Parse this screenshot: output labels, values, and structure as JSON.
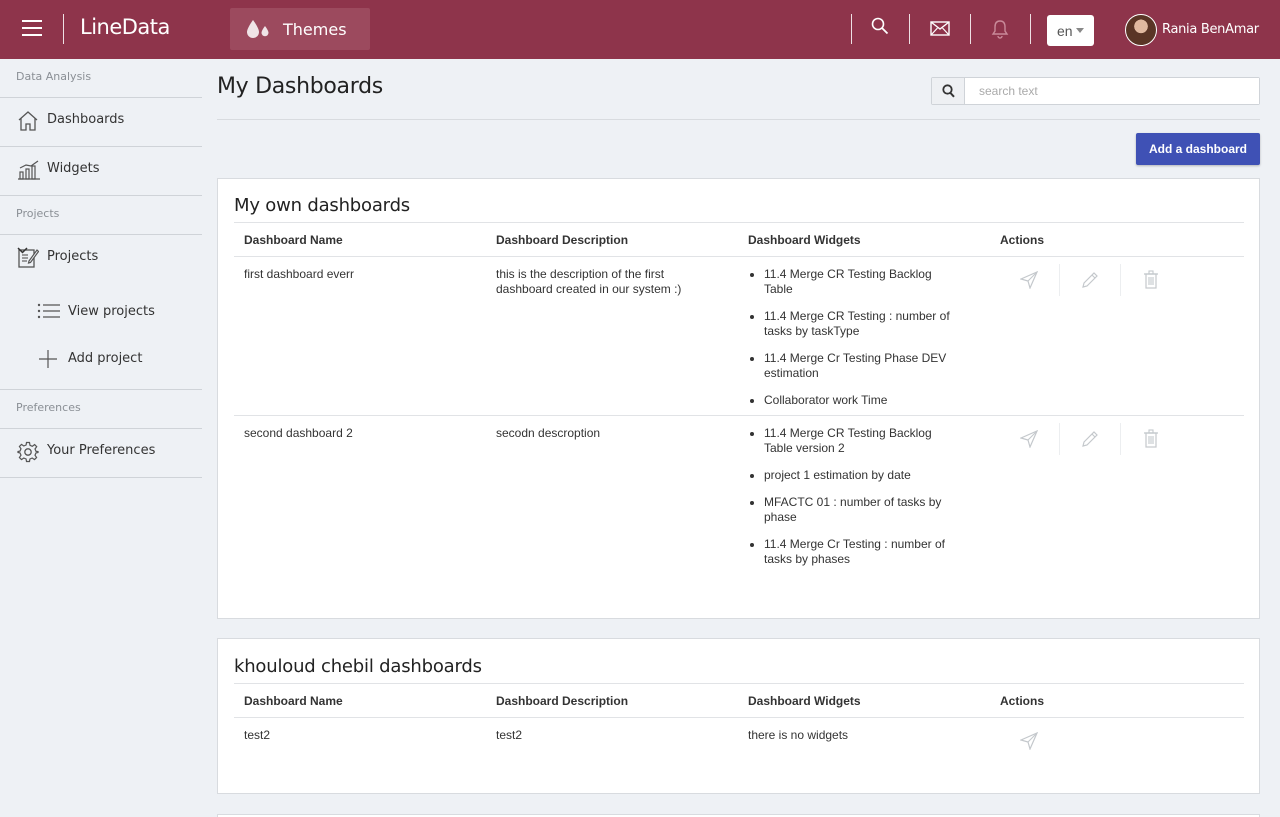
{
  "app": {
    "brand": "LineData",
    "themes_label": "Themes",
    "language": "en",
    "user_name": "Rania BenAmar"
  },
  "sidebar": {
    "section_data_analysis": "Data Analysis",
    "dashboards": "Dashboards",
    "widgets": "Widgets",
    "section_projects": "Projects",
    "projects": "Projects",
    "view_projects": "View projects",
    "add_project": "Add project",
    "section_preferences": "Preferences",
    "your_preferences": "Your Preferences"
  },
  "main": {
    "title": "My Dashboards",
    "search_placeholder": "search text",
    "add_button": "Add a dashboard"
  },
  "columns": {
    "name": "Dashboard Name",
    "description": "Dashboard Description",
    "widgets": "Dashboard Widgets",
    "actions": "Actions"
  },
  "own_panel": {
    "title": "My own dashboards",
    "rows": [
      {
        "name": "first dashboard everr",
        "description": "this is the description of the first dashboard created in our system :)",
        "widgets": [
          "11.4 Merge CR Testing Backlog Table",
          "11.4 Merge CR Testing : number of tasks by taskType",
          "11.4 Merge Cr Testing Phase DEV estimation",
          "Collaborator work Time"
        ]
      },
      {
        "name": "second dashboard 2",
        "description": "secodn descroption",
        "widgets": [
          "11.4 Merge CR Testing Backlog Table version 2",
          "project 1 estimation by date",
          "MFACTC 01 : number of tasks by phase",
          "11.4 Merge Cr Testing : number of tasks by phases"
        ]
      }
    ]
  },
  "shared_panel": {
    "title": "khouloud chebil dashboards",
    "rows": [
      {
        "name": "test2",
        "description": "test2",
        "widgets_text": "there is no widgets"
      }
    ]
  }
}
